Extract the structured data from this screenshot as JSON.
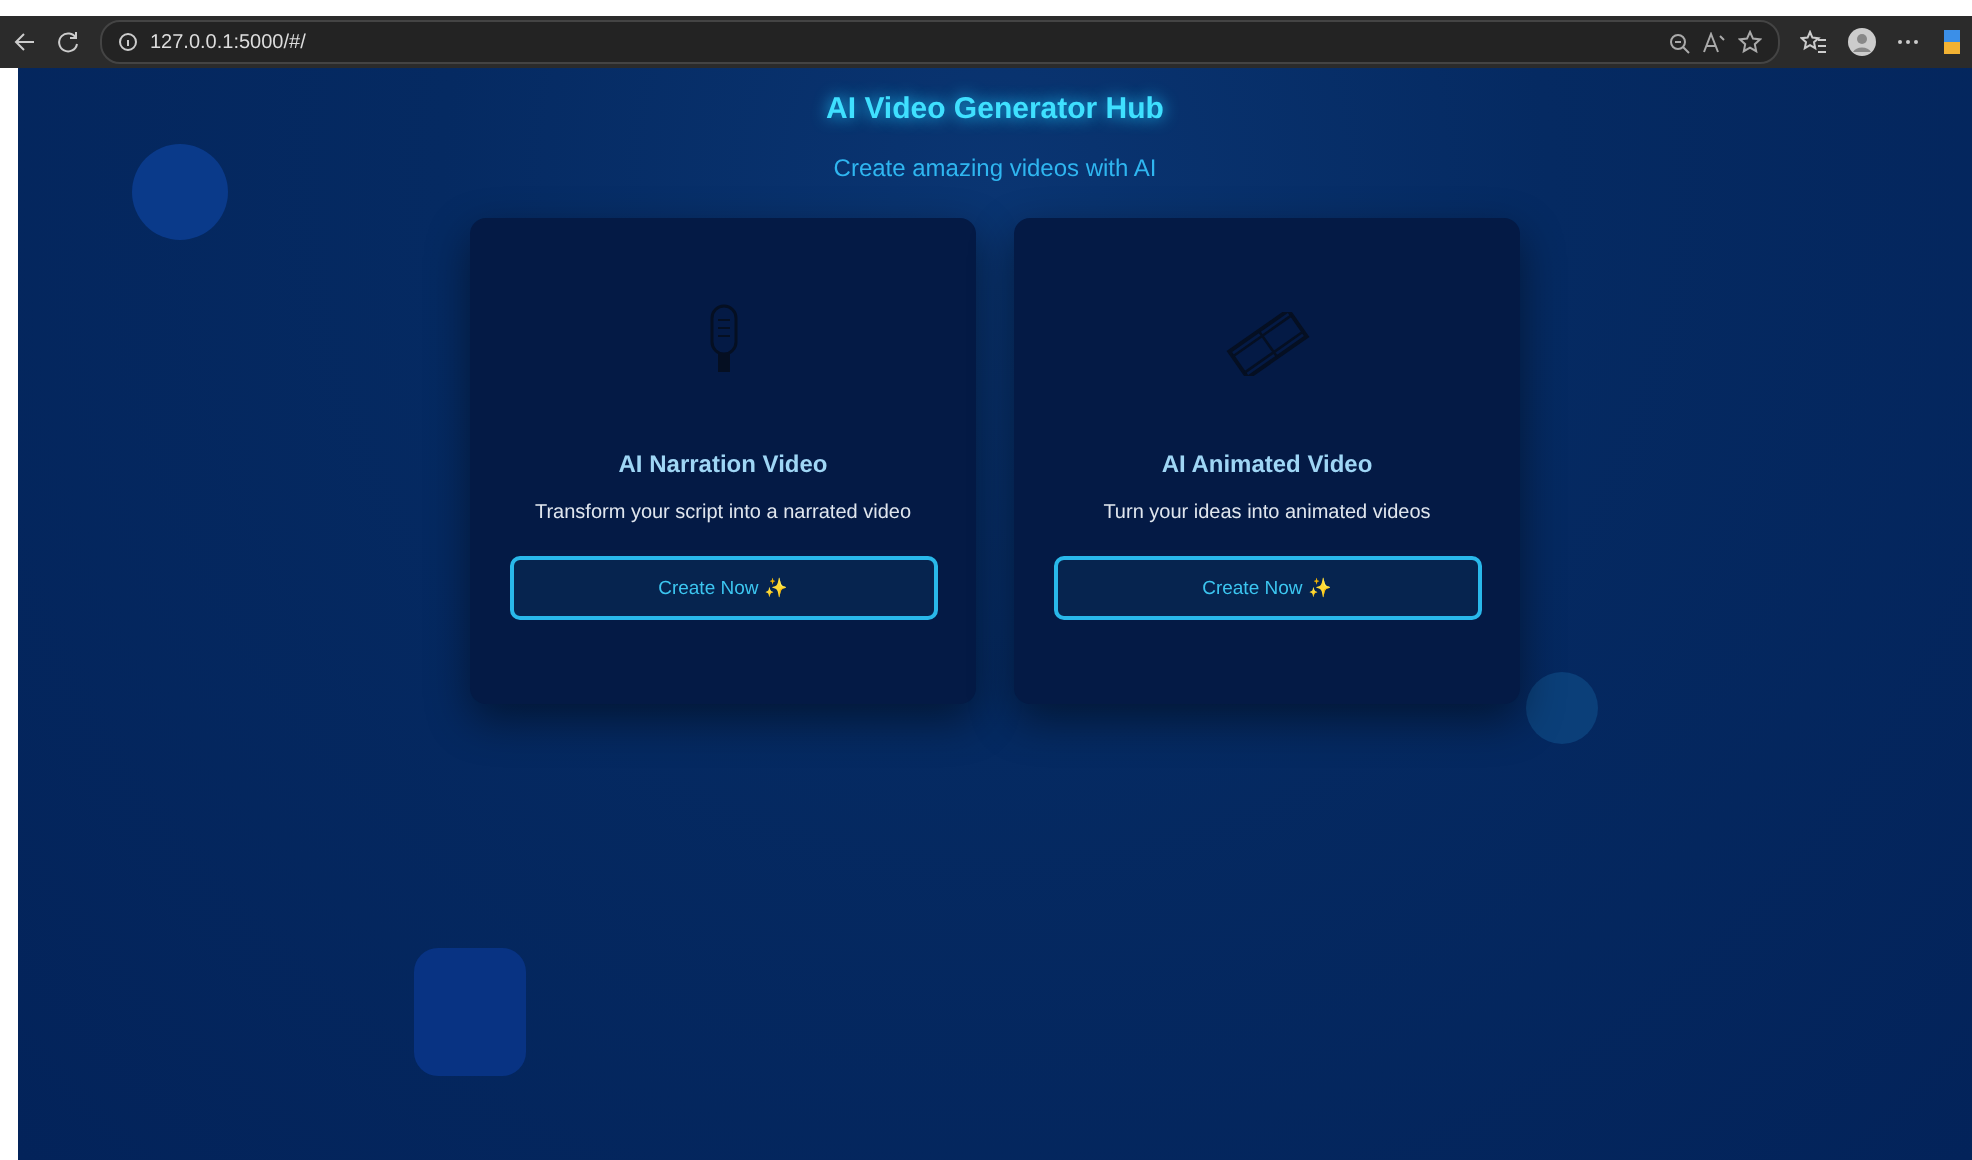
{
  "browser": {
    "url": "127.0.0.1:5000/#/"
  },
  "header": {
    "title": "AI Video Generator Hub",
    "subtitle": "Create amazing videos with AI"
  },
  "cards": [
    {
      "kind": "microphone",
      "title": "AI Narration Video",
      "description": "Transform your script into a narrated video",
      "button": "Create Now ✨"
    },
    {
      "kind": "film",
      "title": "AI Animated Video",
      "description": "Turn your ideas into animated videos",
      "button": "Create Now ✨"
    }
  ]
}
